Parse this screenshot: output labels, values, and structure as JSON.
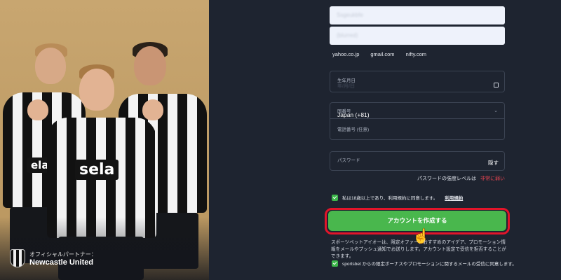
{
  "promo": {
    "sponsor_main": "sela",
    "sponsor_left": "ela",
    "sponsor_right": "se",
    "partner_small": "オフィシャルパートナー：",
    "partner_name": "Newcastle United"
  },
  "form": {
    "username_value": "Ssgeukbfe",
    "email_value": "(blurred)",
    "email_suggestions": [
      "yahoo.co.jp",
      "gmail.com",
      "nifty.com"
    ],
    "dob_label": "生年月日",
    "dob_placeholder": "年/月/日",
    "country_label": "国番号",
    "country_value": "Japan (+81)",
    "phone_label": "電話番号 (任意)",
    "phone_placeholder": "",
    "password_label": "パスワード",
    "password_placeholder": "",
    "password_toggle": "隠す",
    "strength_label": "パスワードの強度レベルは",
    "strength_value": "非常に弱い",
    "age_consent": "私は18歳以上であり、利用規約に同意します。",
    "terms_link": "利用規約",
    "create_button": "アカウントを作成する",
    "marketing_note": "スポーツベットアイオーは、限定オファー、おすすめのアイデア、プロモーション情報をメールやプッシュ通知でお送りします。アカウント設定で受信を拒否することができます。",
    "promo_consent": "sportsbet からの限定ボーナスやプロモーションに関するメールの受信に同意します。"
  },
  "colors": {
    "background": "#1e2430",
    "accent_green": "#49b74d",
    "highlight_red": "#e2152a",
    "weak_red": "#e2434f"
  },
  "icons": [
    "calendar-icon",
    "chevron-down-icon",
    "checkbox-checked-icon",
    "hand-pointer-icon",
    "crest-icon"
  ]
}
